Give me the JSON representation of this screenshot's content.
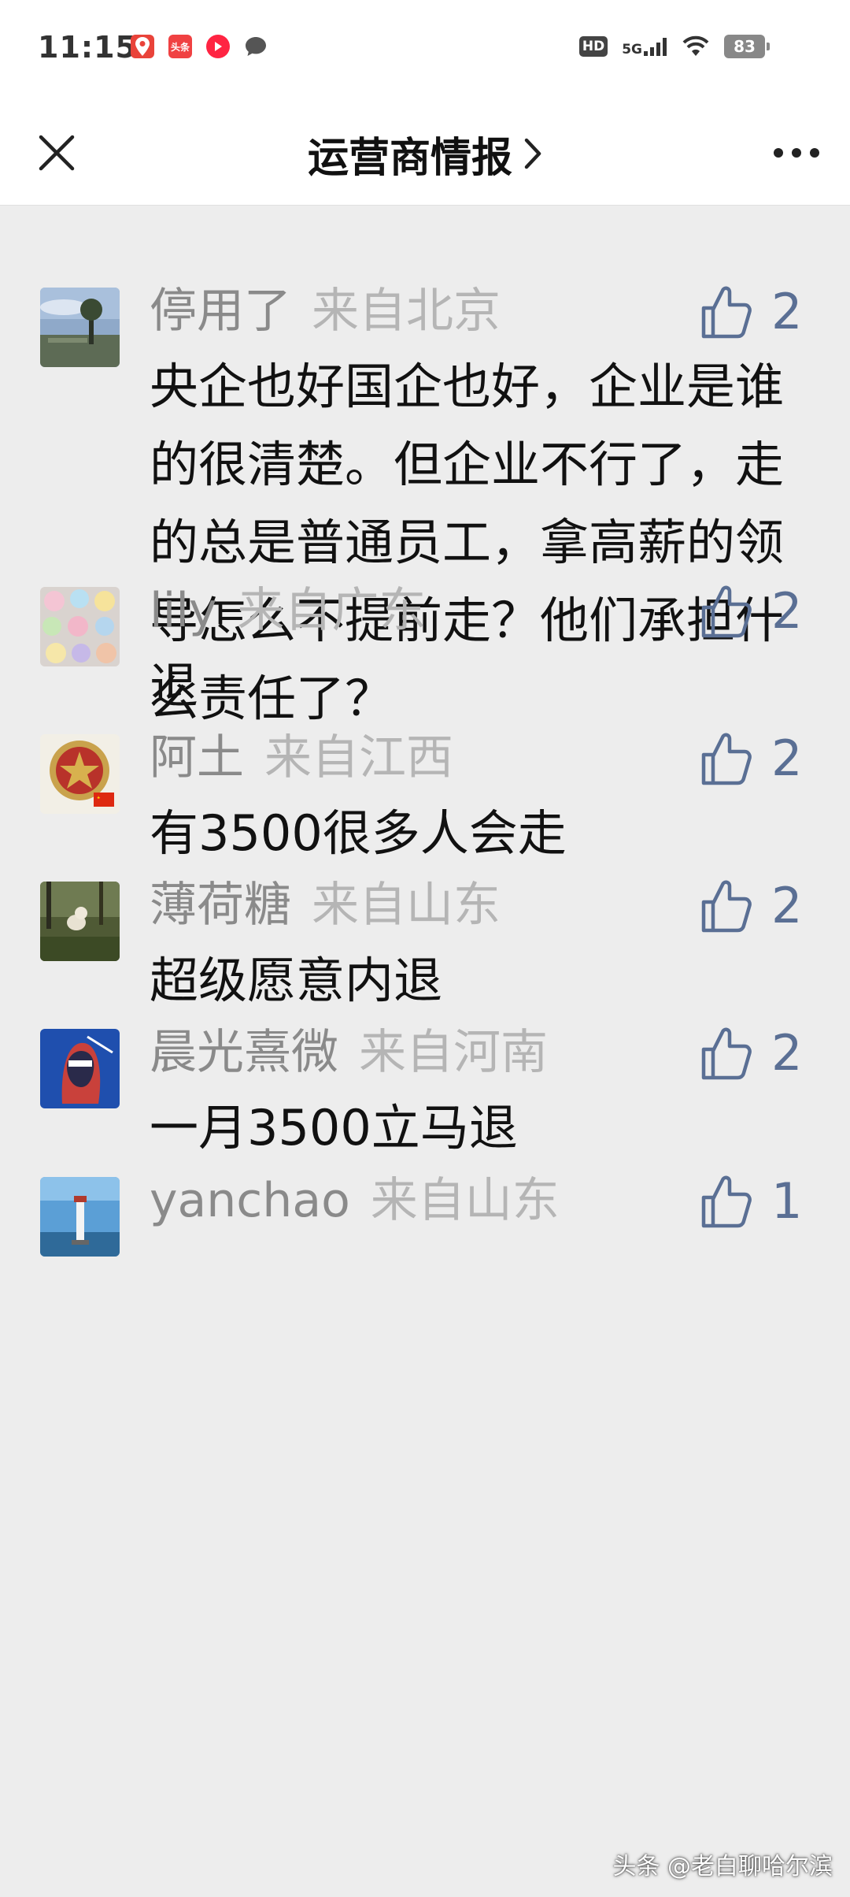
{
  "status_bar": {
    "time": "11:15",
    "app_badge": "头条",
    "hd_label": "HD",
    "network_label": "5G",
    "battery_level": "83"
  },
  "nav": {
    "title": "运营商情报",
    "close_icon": "close-icon",
    "chevron_icon": "chevron-right-icon",
    "more_icon": "more-icon"
  },
  "comments": [
    {
      "nickname": "停用了",
      "region": "来自北京",
      "likes": "2",
      "text": "央企也好国企也好，企业是谁的很清楚。但企业不行了，走的总是普通员工，拿高薪的领导怎么不提前走？他们承担什么责任了？"
    },
    {
      "nickname": "lily",
      "region": "来自广东",
      "likes": "2",
      "text": "退"
    },
    {
      "nickname": "阿土",
      "region": "来自江西",
      "likes": "2",
      "text": "有3500很多人会走"
    },
    {
      "nickname": "薄荷糖",
      "region": "来自山东",
      "likes": "2",
      "text": "超级愿意内退"
    },
    {
      "nickname": "晨光熹微",
      "region": "来自河南",
      "likes": "2",
      "text": "一月3500立马退"
    },
    {
      "nickname": "yanchao",
      "region": "来自山东",
      "likes": "1",
      "text": ""
    }
  ],
  "watermark": "头条 @老白聊哈尔滨",
  "colors": {
    "background": "#ededed",
    "header_bg": "#ffffff",
    "nickname": "#8a8a8a",
    "region": "#b5b5b5",
    "like_blue": "#5a6f94"
  }
}
